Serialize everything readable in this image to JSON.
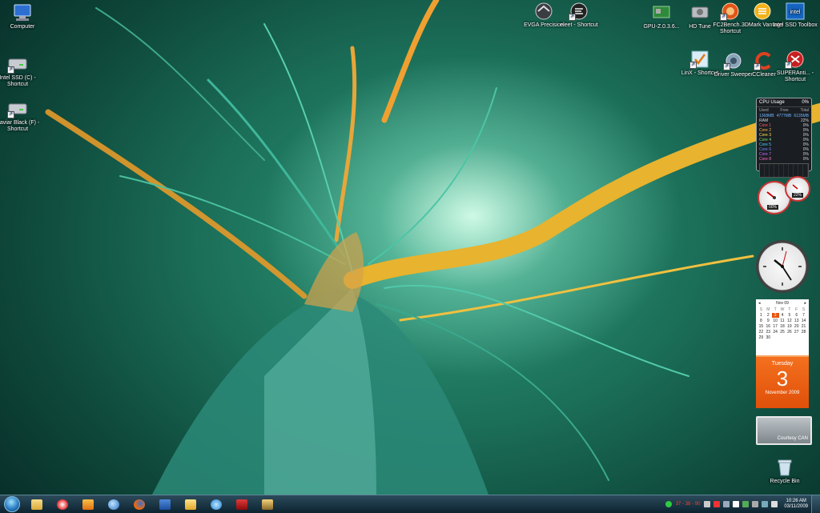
{
  "desktop_icons": {
    "computer": "Computer",
    "intel_ssd": "Intel SSD (C) - Shortcut",
    "caviar_black": "Caviar Black (F) - Shortcut",
    "evga": "EVGA Precision",
    "eleet": "eleet - Shortcut",
    "gpuz": "GPU-Z.0.3.6...",
    "hdtune": "HD Tune",
    "fc2bench": "FC2Bench... - Shortcut",
    "3dmark": "3DMark Vantage",
    "intel_toolbox": "Intel SSD Toolbox",
    "linx": "LinX - Shortcut",
    "driver_sweeper": "Driver Sweeper",
    "ccleaner": "CCleaner",
    "superanti": "SUPERAnti... - Shortcut",
    "recycle_bin": "Recycle Bin"
  },
  "cpu_gadget": {
    "title": "CPU Usage",
    "percent": "0%",
    "col_used": "Used",
    "col_free": "Free",
    "col_total": "Total",
    "used": "1368MB",
    "free": "4777MB",
    "total": "6135MB",
    "ram_label": "RAM",
    "ram_pct": "22%",
    "cores": [
      {
        "label": "Core 1",
        "pct": "0%"
      },
      {
        "label": "Core 2",
        "pct": "0%"
      },
      {
        "label": "Core 3",
        "pct": "0%"
      },
      {
        "label": "Core 4",
        "pct": "0%"
      },
      {
        "label": "Core 5",
        "pct": "0%"
      },
      {
        "label": "Core 6",
        "pct": "0%"
      },
      {
        "label": "Core 7",
        "pct": "0%"
      },
      {
        "label": "Core 8",
        "pct": "0%"
      }
    ]
  },
  "meters": {
    "cpu_readout": "00%",
    "ram_readout": "22%"
  },
  "calendar": {
    "month_label": "Nov 09",
    "weekdays": [
      "S",
      "M",
      "T",
      "W",
      "T",
      "F",
      "S"
    ],
    "days": [
      "1",
      "2",
      "3",
      "4",
      "5",
      "6",
      "7",
      "8",
      "9",
      "10",
      "11",
      "12",
      "13",
      "14",
      "15",
      "16",
      "17",
      "18",
      "19",
      "20",
      "21",
      "22",
      "23",
      "24",
      "25",
      "26",
      "27",
      "28",
      "29",
      "30"
    ],
    "today_index": 2,
    "day_name": "Tuesday",
    "day_number": "3",
    "month_year": "November 2009"
  },
  "slideshow": {
    "caption": "Courtesy CAN"
  },
  "taskbar": {
    "items": [
      "windows-explorer",
      "media-player",
      "media-center",
      "internet-explorer-browser",
      "firefox",
      "word",
      "outlook",
      "internet-explorer",
      "red-app",
      "photo-app"
    ],
    "temps": "37 - 38 - 90",
    "time": "10:26 AM",
    "date": "03/11/2009"
  },
  "colors": {
    "accent_orange": "#e9530d",
    "taskbar_dark": "#0c2330",
    "wallpaper_teal": "#1b6e58"
  }
}
